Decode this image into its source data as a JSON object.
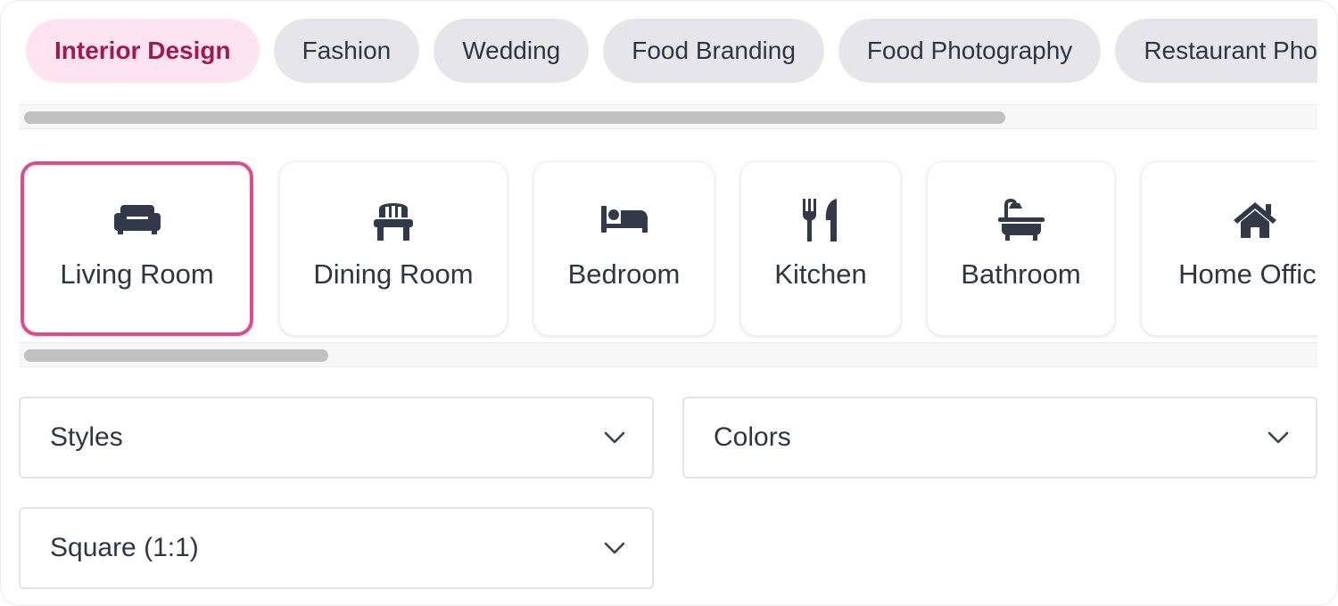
{
  "categories": [
    {
      "label": "Interior Design",
      "active": true
    },
    {
      "label": "Fashion",
      "active": false
    },
    {
      "label": "Wedding",
      "active": false
    },
    {
      "label": "Food Branding",
      "active": false
    },
    {
      "label": "Food Photography",
      "active": false
    },
    {
      "label": "Restaurant Photography",
      "active": false
    }
  ],
  "rooms": [
    {
      "label": "Living Room",
      "icon": "couch-icon",
      "active": true
    },
    {
      "label": "Dining Room",
      "icon": "chair-icon",
      "active": false
    },
    {
      "label": "Bedroom",
      "icon": "bed-icon",
      "active": false
    },
    {
      "label": "Kitchen",
      "icon": "utensils-icon",
      "active": false
    },
    {
      "label": "Bathroom",
      "icon": "bath-icon",
      "active": false
    },
    {
      "label": "Home Office",
      "icon": "home-icon",
      "active": false
    }
  ],
  "selects": {
    "styles": {
      "value": "Styles"
    },
    "colors": {
      "value": "Colors"
    },
    "aspect_ratio": {
      "value": "Square (1:1)"
    }
  },
  "colors": {
    "accent": "#e5488d",
    "active_pill_bg": "#fde4f0",
    "active_pill_text": "#a5184e",
    "pill_bg": "#e6e6ea",
    "text": "#2f3643"
  }
}
